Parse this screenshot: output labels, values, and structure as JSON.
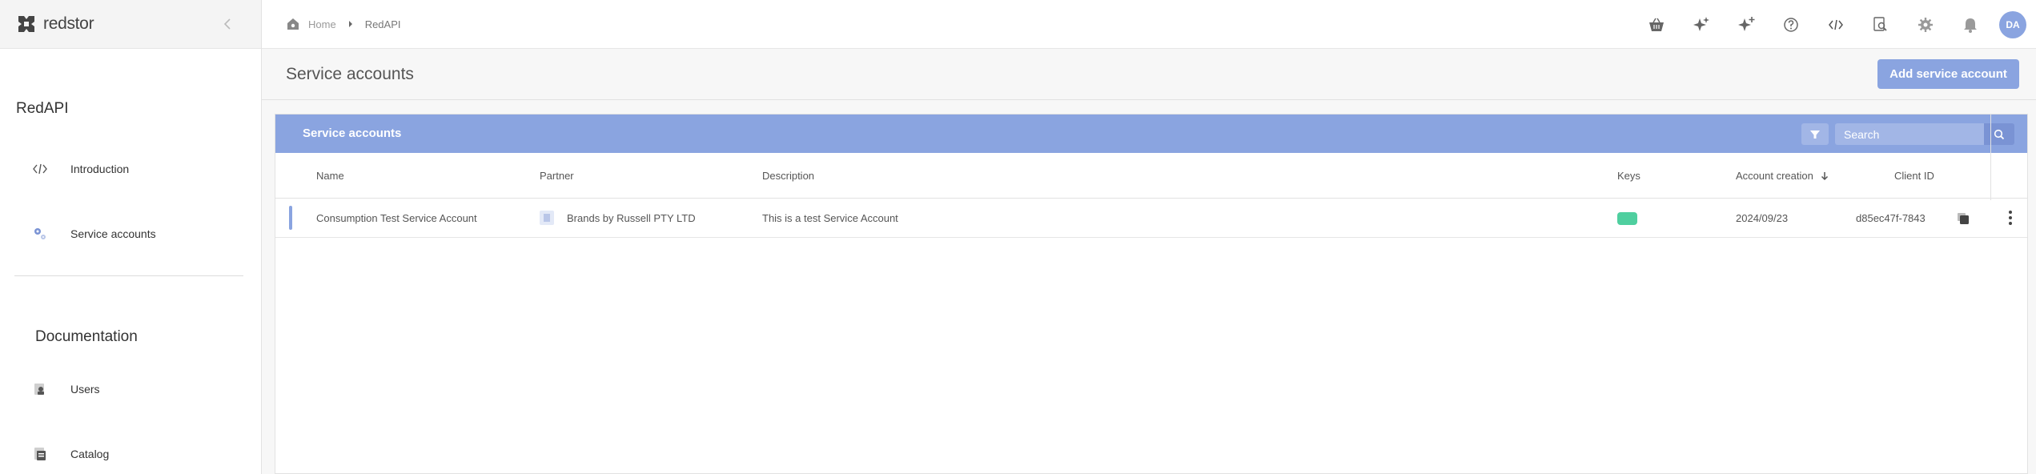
{
  "brand": {
    "name": "redstor"
  },
  "sidebar": {
    "section_title": "RedAPI",
    "items": [
      {
        "label": "Introduction",
        "icon": "code-icon"
      },
      {
        "label": "Service accounts",
        "icon": "gears-icon"
      }
    ],
    "documentation_title": "Documentation",
    "doc_items": [
      {
        "label": "Users",
        "icon": "users-doc-icon"
      },
      {
        "label": "Catalog",
        "icon": "catalog-doc-icon"
      }
    ]
  },
  "breadcrumb": {
    "home": "Home",
    "current": "RedAPI"
  },
  "topbar": {
    "icons": [
      "basket-icon",
      "sparkle-icon",
      "sparkle-plus-icon",
      "help-icon",
      "code-icon",
      "search-doc-icon",
      "gear-icon",
      "bell-icon"
    ],
    "avatar_initials": "DA"
  },
  "page": {
    "title": "Service accounts",
    "add_button": "Add service account"
  },
  "panel": {
    "title": "Service accounts",
    "search_placeholder": "Search",
    "columns": {
      "name": "Name",
      "partner": "Partner",
      "description": "Description",
      "keys": "Keys",
      "account_creation": "Account creation",
      "client_id": "Client ID"
    },
    "rows": [
      {
        "name": "Consumption Test Service Account",
        "partner": "Brands by Russell PTY LTD",
        "description": "This is a test Service Account",
        "created": "2024/09/23",
        "client_id": "d85ec47f-7843"
      }
    ]
  },
  "colors": {
    "accent": "#8aa4e0",
    "key_active": "#4fcf9f"
  }
}
